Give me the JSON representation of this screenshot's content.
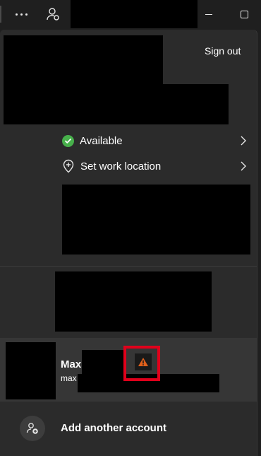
{
  "header": {
    "sign_out_label": "Sign out"
  },
  "status": {
    "availability_label": "Available",
    "work_location_label": "Set work location",
    "available_color": "#47b04b"
  },
  "accounts": [
    {
      "name_visible": "Max",
      "email_visible": "max",
      "warning_icon": "warning-triangle-icon",
      "warning_color": "#e0601b",
      "highlight_color": "#e0001b"
    }
  ],
  "add_account": {
    "label": "Add another account",
    "icon": "add-person-icon"
  },
  "titlebar_icons": [
    "more-icon",
    "presence-person-icon",
    "minimize-icon",
    "maximize-icon"
  ]
}
